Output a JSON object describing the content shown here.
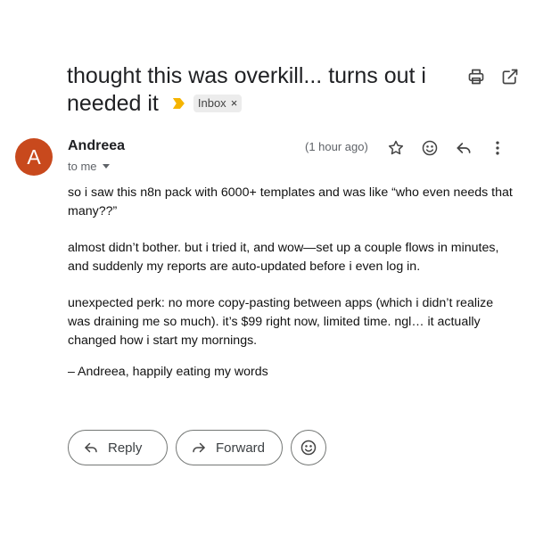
{
  "email": {
    "subject": "thought this was overkill... turns out i needed it",
    "label": "Inbox",
    "label_remove": "×",
    "sender_name": "Andreea",
    "avatar_letter": "A",
    "recipient": "to me",
    "time": "(1 hour ago)",
    "body": {
      "p1": "so i saw this n8n pack with 6000+ templates and was like “who even needs that many??”",
      "p2": "almost didn’t bother. but i tried it, and wow—set up a couple flows in minutes, and suddenly my reports are auto-updated before i even log in.",
      "p3": "unexpected perk: no more copy-pasting between apps (which i didn’t realize was draining me so much). it’s $99 right now, limited time. ngl… it actually changed how i start my mornings.",
      "signature": "– Andreea, happily eating my words"
    }
  },
  "actions": {
    "reply": "Reply",
    "forward": "Forward"
  },
  "icons": {
    "print": "print-icon",
    "open_new_window": "open-in-new-window-icon",
    "star": "star-icon",
    "emoji": "emoji-icon",
    "reply": "reply-icon",
    "more": "more-vert-icon",
    "forward": "forward-icon",
    "importance": "importance-marker-icon"
  },
  "colors": {
    "avatar_bg": "#c8491d",
    "importance_marker": "#f5b400",
    "label_bg": "#ececec",
    "text_primary": "#202124",
    "text_secondary": "#5f6368"
  }
}
